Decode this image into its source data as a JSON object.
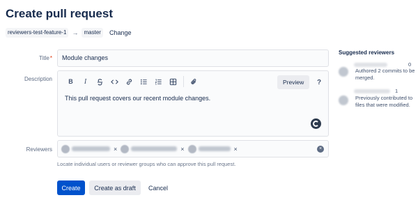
{
  "page": {
    "title": "Create pull request"
  },
  "branches": {
    "source": "reviewers-test-feature-1",
    "arrow": "→",
    "destination": "master",
    "change_label": "Change"
  },
  "form": {
    "title_label": "Title",
    "required_mark": "*",
    "title_value": "Module changes",
    "description_label": "Description",
    "description_text": "This pull request covers our recent module changes.",
    "reviewers_label": "Reviewers",
    "reviewers_help": "Locate individual users or reviewer groups who can approve this pull request.",
    "reviewer_remove_glyph": "×",
    "clear_glyph": "×"
  },
  "toolbar": {
    "bold": "B",
    "italic": "I",
    "preview_label": "Preview",
    "help_label": "?"
  },
  "actions": {
    "create_label": "Create",
    "draft_label": "Create as draft",
    "cancel_label": "Cancel"
  },
  "suggested": {
    "title": "Suggested reviewers",
    "items": [
      {
        "count": "0",
        "reason": "Authored 2 commits to be merged."
      },
      {
        "count": "1",
        "reason": "Previously contributed to files that were modified."
      }
    ]
  },
  "colors": {
    "primary": "#0052cc",
    "text": "#172b4d",
    "subtle": "#5e6c84",
    "border": "#dfe1e6",
    "required": "#de350b"
  }
}
